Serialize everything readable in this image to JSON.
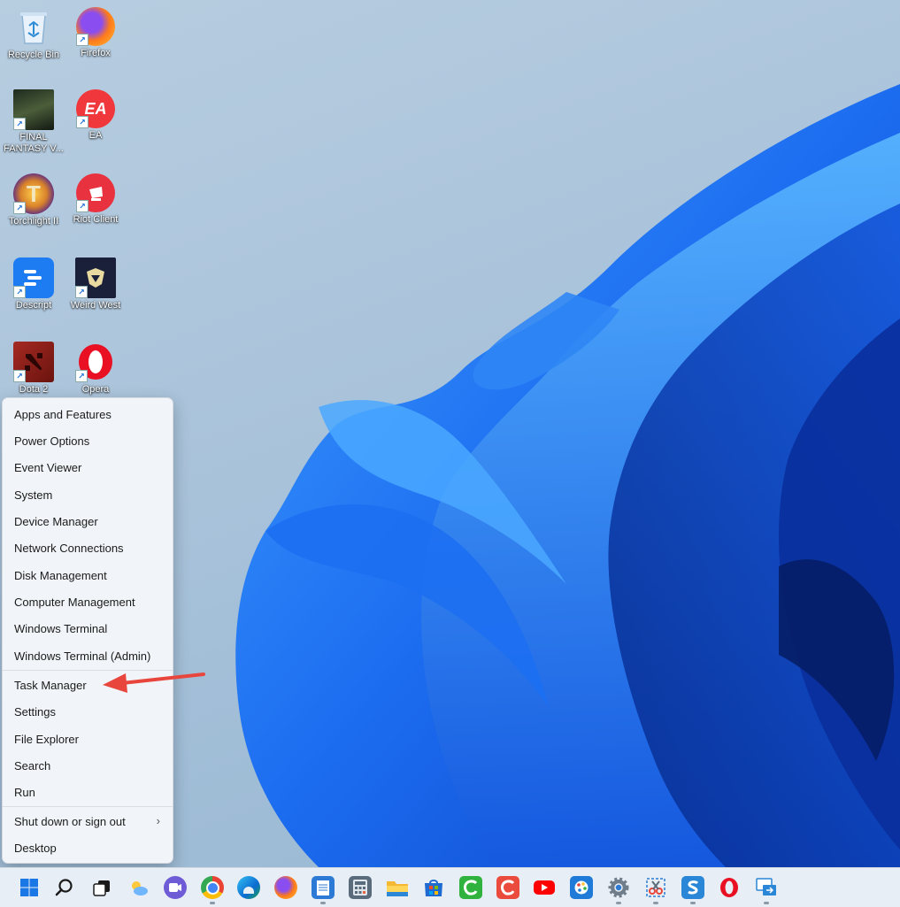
{
  "desktop": {
    "icons": [
      {
        "label": "Recycle Bin",
        "icon": "recycle-bin-icon"
      },
      {
        "label": "Firefox",
        "icon": "firefox-icon"
      },
      {
        "label": "FINAL FANTASY V...",
        "icon": "final-fantasy-icon"
      },
      {
        "label": "EA",
        "icon": "ea-icon"
      },
      {
        "label": "Torchlight II",
        "icon": "torchlight-icon"
      },
      {
        "label": "Riot Client",
        "icon": "riot-client-icon"
      },
      {
        "label": "Descript",
        "icon": "descript-icon"
      },
      {
        "label": "Weird West",
        "icon": "weird-west-icon"
      },
      {
        "label": "Dota 2",
        "icon": "dota-icon"
      },
      {
        "label": "Opera",
        "icon": "opera-icon"
      }
    ],
    "ea_glyph": "EA",
    "torchlight_glyph": "T",
    "shortcut_glyph": "↗"
  },
  "menu": {
    "items": [
      "Apps and Features",
      "Power Options",
      "Event Viewer",
      "System",
      "Device Manager",
      "Network Connections",
      "Disk Management",
      "Computer Management",
      "Windows Terminal",
      "Windows Terminal (Admin)",
      "Task Manager",
      "Settings",
      "File Explorer",
      "Search",
      "Run",
      "Shut down or sign out",
      "Desktop"
    ],
    "submenu_chevron": "›"
  },
  "taskbar": {
    "icons": [
      "start-icon",
      "search-icon",
      "task-view-icon",
      "widgets-icon",
      "chat-icon",
      "chrome-icon",
      "edge-icon",
      "firefox-icon",
      "notepad-icon",
      "calculator-icon",
      "file-explorer-icon",
      "store-icon",
      "camtasia-icon",
      "camtasia-recorder-icon",
      "youtube-icon",
      "paint-icon",
      "settings-icon",
      "snipping-tool-icon",
      "snagit-icon",
      "opera-icon",
      "remote-icon"
    ]
  },
  "colors": {
    "accent": "#1a6fd6",
    "arrow": "#e8453c",
    "menu_bg": "#f1f4f8"
  }
}
